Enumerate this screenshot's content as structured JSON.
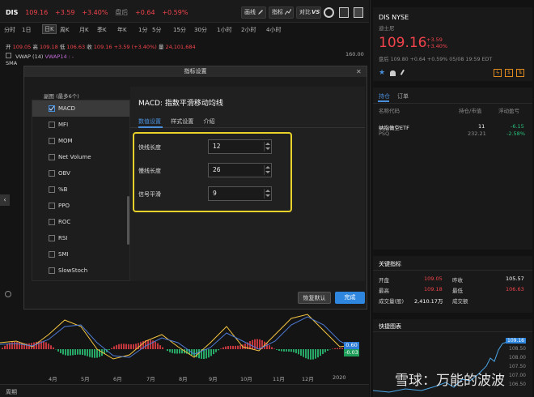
{
  "toolbar": {
    "symbol": "DIS",
    "price": "109.16",
    "chg": "+3.59",
    "chg_pct": "+3.40%",
    "after_label": "盘后",
    "after_chg": "+0.64",
    "after_pct": "+0.59%",
    "btn_draw": "画线",
    "btn_indicator": "指标",
    "btn_compare": "对比"
  },
  "timeframes": [
    "分时",
    "1日",
    "日K",
    "周K",
    "月K",
    "季K",
    "年K",
    "1分",
    "5分",
    "15分",
    "30分",
    "1小时",
    "2小时",
    "4小时"
  ],
  "timeframe_selected": "日K",
  "ohlc": {
    "open_l": "开",
    "open": "109.05",
    "high_l": "高",
    "high": "109.18",
    "low_l": "低",
    "low": "106.63",
    "close_l": "收",
    "close": "109.16",
    "chg": "+3.59 (+3.40%)",
    "vol_l": "量",
    "vol": "24,101,684"
  },
  "indicators": {
    "vwap": "VWAP (14)",
    "vwap2": "VWAP14 : -",
    "sma": "SMA"
  },
  "price_axis": {
    "p160": "160.00"
  },
  "bottom": {
    "macd_badge": "0.60",
    "macd_badge2": "-0.03",
    "months": [
      "4月",
      "5月",
      "6月",
      "7月",
      "8月",
      "9月",
      "10月",
      "11月",
      "12月",
      "2020"
    ],
    "period": "周期"
  },
  "dialog": {
    "title": "指标设置",
    "list_header": "副图 (最多6个)",
    "items": [
      "MACD",
      "MFI",
      "MOM",
      "Net Volume",
      "OBV",
      "%B",
      "PPO",
      "ROC",
      "RSI",
      "SMI",
      "SlowStoch"
    ],
    "selected": "MACD",
    "heading": "MACD: 指数平滑移动均线",
    "tabs": [
      "数值设置",
      "样式设置",
      "介绍"
    ],
    "fields": [
      {
        "label": "快线长度",
        "value": "12"
      },
      {
        "label": "慢线长度",
        "value": "26"
      },
      {
        "label": "信号平滑",
        "value": "9"
      }
    ],
    "reset": "恢复默认",
    "done": "完成"
  },
  "quote": {
    "symbol": "DIS NYSE",
    "name": "迪士尼",
    "price": "109.16",
    "chg": "+3.59",
    "pct": "+3.40%",
    "after": "盘后 109.80 +0.64 +0.59% 05/08 19:59 EDT"
  },
  "positions": {
    "tabs": [
      "持仓",
      "订单"
    ],
    "headers": [
      "名称代码",
      "持仓/市值",
      "浮动盈亏"
    ],
    "rows": [
      {
        "name": "纳指做空ETF",
        "code": "PSQ",
        "qty": "11",
        "value": "232.21",
        "pnl": "-6.15",
        "pnl_pct": "-2.58%"
      }
    ]
  },
  "key_stats": {
    "title": "关键指标",
    "rows": [
      {
        "l1": "开盘",
        "v1": "109.05",
        "l2": "昨收",
        "v2": "105.57"
      },
      {
        "l1": "最高",
        "v1": "109.18",
        "l2": "最低",
        "v2": "106.63"
      },
      {
        "l1": "成交量(股)",
        "v1": "2,410.17万",
        "l2": "成交额",
        "v2": ""
      }
    ]
  },
  "mini_chart": {
    "title": "快捷图表",
    "p1": "109.16",
    "p2": "108.50",
    "p3": "108.00",
    "p4": "107.50",
    "p5": "107.00",
    "p6": "106.50"
  },
  "watermark": "雪球：万能的波波",
  "colors": {
    "up": "#f2434b",
    "down": "#28c07a",
    "accent": "#4a8fdc",
    "highlight": "#e8d22a"
  }
}
